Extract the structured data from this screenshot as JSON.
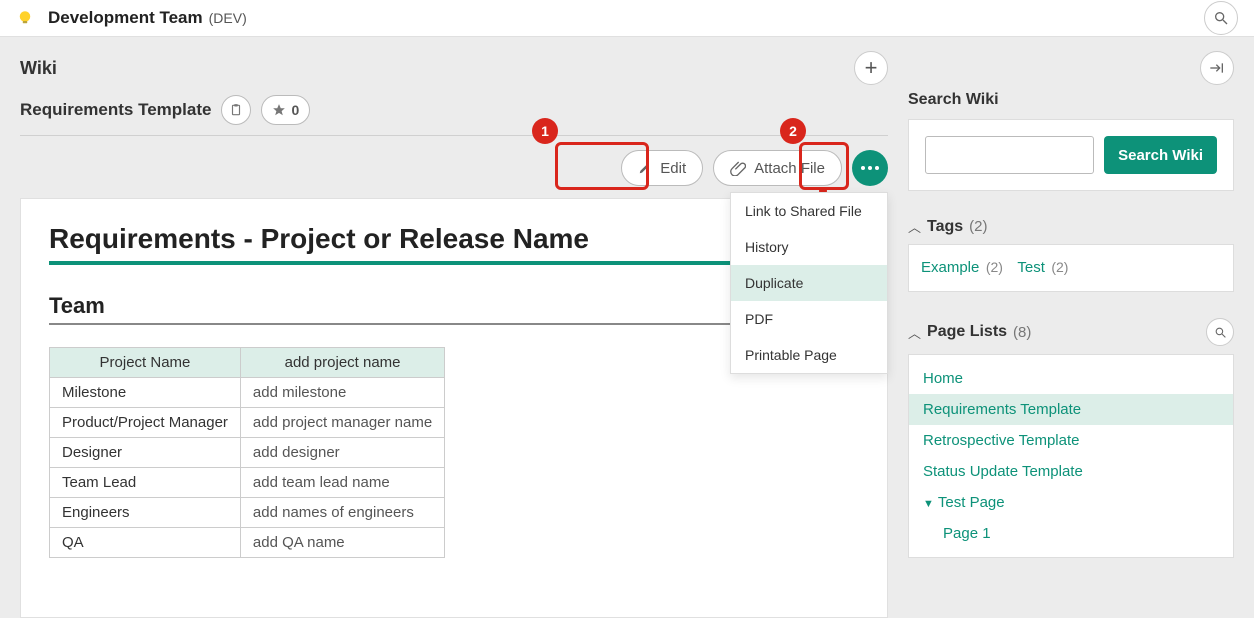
{
  "topbar": {
    "team_name": "Development Team",
    "team_code": "(DEV)"
  },
  "wiki": {
    "heading": "Wiki",
    "page_title": "Requirements Template",
    "star_count": "0",
    "actions": {
      "edit": "Edit",
      "attach": "Attach File"
    },
    "dropdown": [
      "Link to Shared File",
      "History",
      "Duplicate",
      "PDF",
      "Printable Page"
    ],
    "annotations": {
      "badge1": "1",
      "badge2": "2"
    }
  },
  "document": {
    "h1": "Requirements - Project or Release Name",
    "h2": "Team",
    "table": {
      "headers": [
        "Project Name",
        "add project name"
      ],
      "rows": [
        [
          "Milestone",
          "add milestone"
        ],
        [
          "Product/Project Manager",
          "add project manager name"
        ],
        [
          "Designer",
          "add designer"
        ],
        [
          "Team Lead",
          "add team lead name"
        ],
        [
          "Engineers",
          "add names of engineers"
        ],
        [
          "QA",
          "add QA name"
        ]
      ]
    }
  },
  "sidebar": {
    "search_wiki": {
      "title": "Search Wiki",
      "button": "Search Wiki"
    },
    "tags": {
      "label": "Tags",
      "count": "(2)",
      "items": [
        {
          "name": "Example",
          "count": "(2)"
        },
        {
          "name": "Test",
          "count": "(2)"
        }
      ]
    },
    "page_lists": {
      "label": "Page Lists",
      "count": "(8)",
      "items": [
        {
          "label": "Home"
        },
        {
          "label": "Requirements Template",
          "active": true
        },
        {
          "label": "Retrospective Template"
        },
        {
          "label": "Status Update Template"
        },
        {
          "label": "Test Page",
          "caret": true
        },
        {
          "label": "Page 1",
          "indent": true
        }
      ]
    }
  }
}
